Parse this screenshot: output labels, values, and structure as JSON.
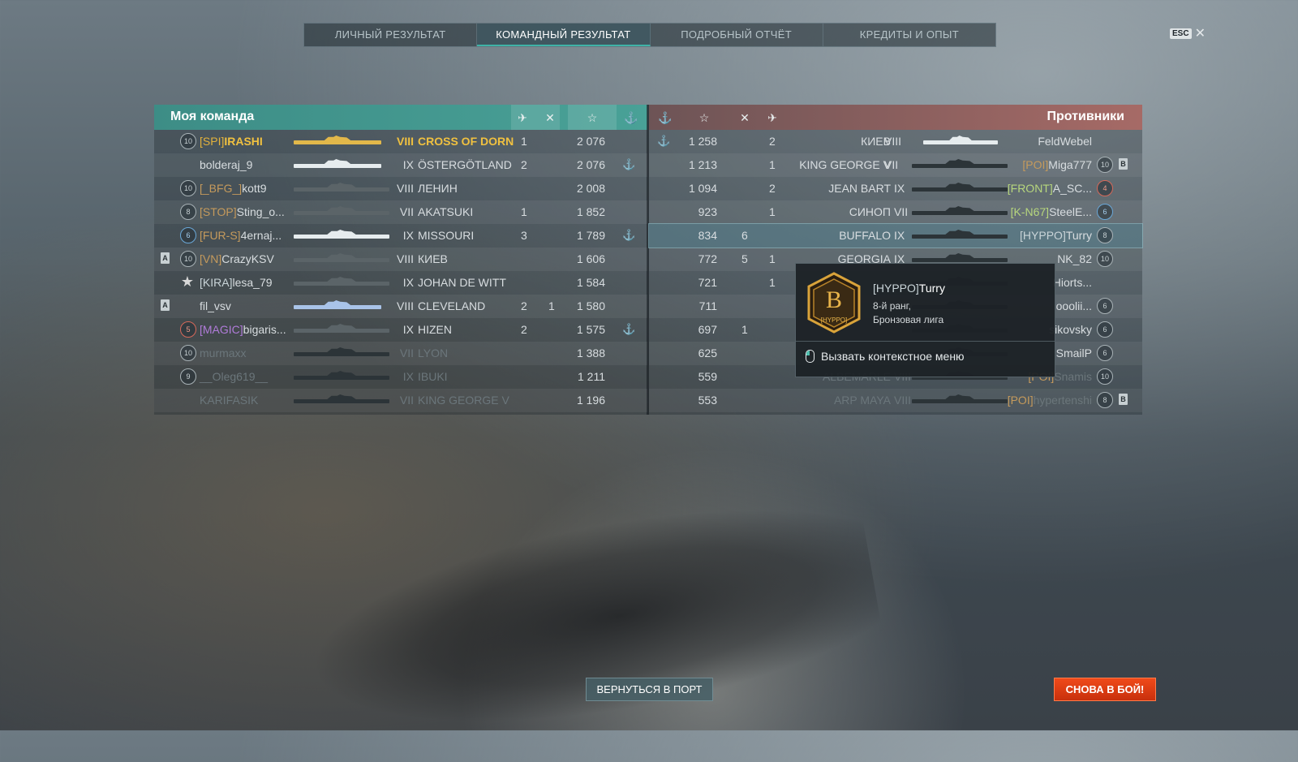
{
  "tabs": {
    "personal": "ЛИЧНЫЙ РЕЗУЛЬТАТ",
    "team": "КОМАНДНЫЙ РЕЗУЛЬТАТ",
    "detailed": "ПОДРОБНЫЙ ОТЧЁТ",
    "credits": "КРЕДИТЫ И ОПЫТ"
  },
  "esc": {
    "key": "ESC",
    "close": "✕"
  },
  "my_team": {
    "title": "Моя команда",
    "rows": [
      {
        "rank": "10",
        "clan": "[SPI]",
        "name": "IRASHI",
        "tier": "VIII",
        "ship": "CROSS OF DORN",
        "kills": "1",
        "ribbons": "",
        "xp": "2 076",
        "medal": ""
      },
      {
        "rank": "",
        "clan": "",
        "name": "bolderaj_9",
        "tier": "IX",
        "ship": "ÖSTERGÖTLAND",
        "kills": "2",
        "ribbons": "",
        "xp": "2 076",
        "medal": "⚓"
      },
      {
        "rank": "10",
        "clan": "[_BFG_]",
        "name": "kott9",
        "tier": "VIII",
        "ship": "ЛЕНИН",
        "kills": "",
        "ribbons": "",
        "xp": "2 008",
        "medal": ""
      },
      {
        "rank": "8",
        "clan": "[STOP]",
        "name": "Sting_o...",
        "tier": "VII",
        "ship": "AKATSUKI",
        "kills": "1",
        "ribbons": "",
        "xp": "1 852",
        "medal": ""
      },
      {
        "rank": "6",
        "clan": "[FUR-S]",
        "name": "4ernaj...",
        "tier": "IX",
        "ship": "MISSOURI",
        "kills": "3",
        "ribbons": "",
        "xp": "1 789",
        "medal": "⚓"
      },
      {
        "rank": "10",
        "clan": "[VN]",
        "name": "CrazyKSV",
        "tier": "VIII",
        "ship": "КИЕВ",
        "kills": "",
        "ribbons": "",
        "xp": "1 606",
        "medal": "",
        "badge": "A"
      },
      {
        "rank": "★",
        "clan": "[KIRA]",
        "name": "lesa_79",
        "tier": "IX",
        "ship": "JOHAN DE WITT",
        "kills": "",
        "ribbons": "",
        "xp": "1 584",
        "medal": ""
      },
      {
        "rank": "",
        "clan": "",
        "name": "fil_vsv",
        "tier": "VIII",
        "ship": "CLEVELAND",
        "kills": "2",
        "ribbons": "1",
        "xp": "1 580",
        "medal": "",
        "badge": "A"
      },
      {
        "rank": "5",
        "clan": "[MAGIC]",
        "name": "bigaris...",
        "tier": "IX",
        "ship": "HIZEN",
        "kills": "2",
        "ribbons": "",
        "xp": "1 575",
        "medal": "⚓"
      },
      {
        "rank": "10",
        "clan": "",
        "name": "murmaxx",
        "tier": "VII",
        "ship": "LYON",
        "kills": "",
        "ribbons": "",
        "xp": "1 388",
        "medal": ""
      },
      {
        "rank": "9",
        "clan": "",
        "name": "__Oleg619__",
        "tier": "IX",
        "ship": "IBUKI",
        "kills": "",
        "ribbons": "",
        "xp": "1 211",
        "medal": ""
      },
      {
        "rank": "",
        "clan": "",
        "name": "KARIFASIK",
        "tier": "VII",
        "ship": "KING GEORGE V",
        "kills": "",
        "ribbons": "",
        "xp": "1 196",
        "medal": ""
      }
    ]
  },
  "enemy_team": {
    "title": "Противники",
    "rows": [
      {
        "medal": "⚓",
        "xp": "1 258",
        "ribbons": "",
        "kills": "2",
        "ship": "КИЕВ",
        "tier": "VIII",
        "clan": "",
        "name": "FeldWebel",
        "rank": ""
      },
      {
        "medal": "",
        "xp": "1 213",
        "ribbons": "",
        "kills": "1",
        "ship": "KING GEORGE V",
        "tier": "VII",
        "clan": "[POI]",
        "name": "Miga777",
        "rank": "10",
        "badge": "B"
      },
      {
        "medal": "",
        "xp": "1 094",
        "ribbons": "",
        "kills": "2",
        "ship": "JEAN BART",
        "tier": "IX",
        "clan": "[FRONT]",
        "name": "A_SC...",
        "rank": "4"
      },
      {
        "medal": "",
        "xp": "923",
        "ribbons": "",
        "kills": "1",
        "ship": "СИНОП",
        "tier": "VII",
        "clan": "[K-N67]",
        "name": "SteelE...",
        "rank": "6"
      },
      {
        "medal": "",
        "xp": "834",
        "ribbons": "6",
        "kills": "",
        "ship": "BUFFALO",
        "tier": "IX",
        "clan": "[HYPPO]",
        "name": "Turry",
        "rank": "8"
      },
      {
        "medal": "",
        "xp": "772",
        "ribbons": "5",
        "kills": "1",
        "ship": "GEORGIA",
        "tier": "IX",
        "clan": "",
        "name": "NK_82",
        "rank": "10"
      },
      {
        "medal": "",
        "xp": "721",
        "ribbons": "",
        "kills": "1",
        "ship": "",
        "tier": "",
        "clan": "",
        "name": "Hiorts...",
        "rank": ""
      },
      {
        "medal": "",
        "xp": "711",
        "ribbons": "",
        "kills": "",
        "ship": "",
        "tier": "",
        "clan": "",
        "name": "ooolii...",
        "rank": "6"
      },
      {
        "medal": "",
        "xp": "697",
        "ribbons": "1",
        "kills": "",
        "ship": "",
        "tier": "",
        "clan": "",
        "name": "sikovsky",
        "rank": "6"
      },
      {
        "medal": "",
        "xp": "625",
        "ribbons": "",
        "kills": "",
        "ship": "",
        "tier": "",
        "clan": "",
        "name": "SmailP",
        "rank": "6"
      },
      {
        "medal": "",
        "xp": "559",
        "ribbons": "",
        "kills": "",
        "ship": "ALBEMARLE",
        "tier": "VIII",
        "clan": "[POI]",
        "name": "Snamis",
        "rank": "10"
      },
      {
        "medal": "",
        "xp": "553",
        "ribbons": "",
        "kills": "",
        "ship": "ARP MAYA",
        "tier": "VIII",
        "clan": "[POI]",
        "name": "hypertenshi",
        "rank": "8",
        "badge": "B"
      }
    ]
  },
  "tooltip": {
    "clan": "[HYPPO]",
    "name": "Turry",
    "rank_line": "8-й ранг,",
    "league": "Бронзовая лига",
    "emblem_letter": "В",
    "emblem_tag": "[HYPPO]",
    "action": "Вызвать контекстное меню"
  },
  "buttons": {
    "port": "ВЕРНУТЬСЯ В ПОРТ",
    "battle": "СНОВА В БОЙ!"
  }
}
